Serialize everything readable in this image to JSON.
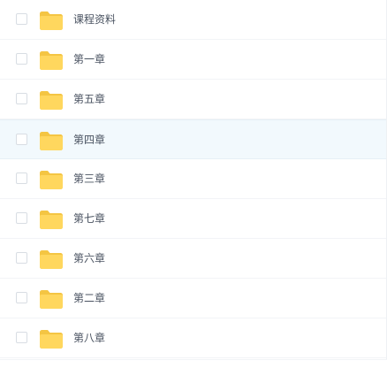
{
  "file_list": {
    "items": [
      {
        "name": "课程资料",
        "selected": false
      },
      {
        "name": "第一章",
        "selected": false
      },
      {
        "name": "第五章",
        "selected": false
      },
      {
        "name": "第四章",
        "selected": true
      },
      {
        "name": "第三章",
        "selected": false
      },
      {
        "name": "第七章",
        "selected": false
      },
      {
        "name": "第六章",
        "selected": false
      },
      {
        "name": "第二章",
        "selected": false
      },
      {
        "name": "第八章",
        "selected": false
      }
    ],
    "icon": "folder-icon",
    "colors": {
      "folder_front": "#ffd75e",
      "folder_back": "#f4c543",
      "selected_row": "#f2f9fd",
      "text": "#4a5361"
    }
  }
}
